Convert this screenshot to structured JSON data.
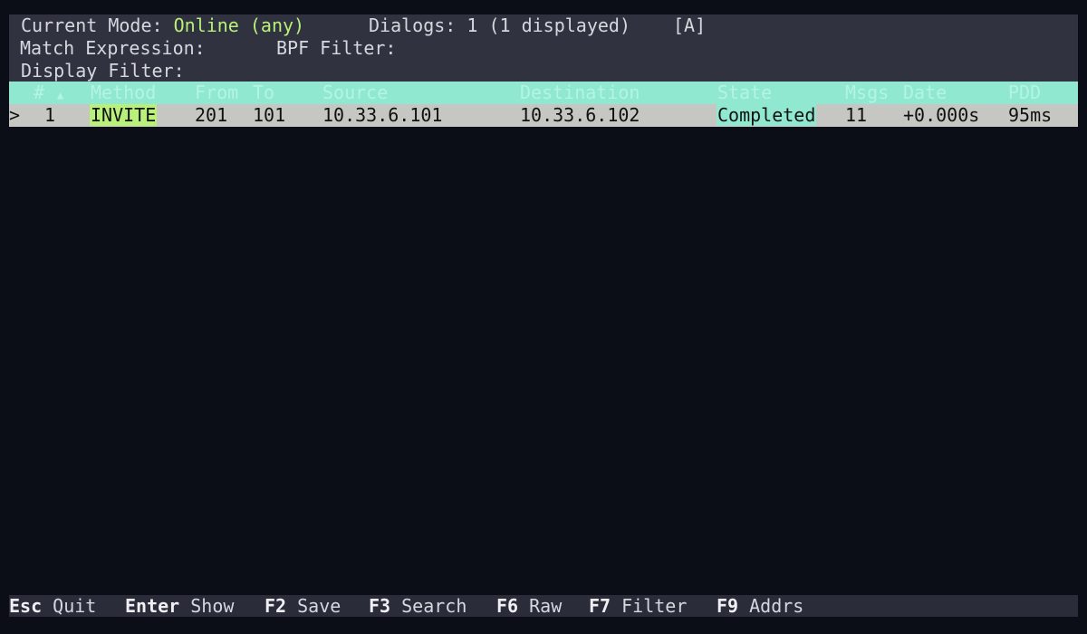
{
  "header": {
    "mode_label": "Current Mode: ",
    "mode_value": "Online (any)",
    "dialogs_text": "Dialogs: 1 (1 displayed)",
    "indicator": "[A]",
    "match_expression_label": "Match Expression:",
    "bpf_filter_label": "BPF Filter:",
    "display_filter_label": "Display Filter:"
  },
  "columns": {
    "num": "#",
    "sort": "▲",
    "method": "Method",
    "from": "From",
    "to": "To",
    "source": "Source",
    "destination": "Destination",
    "state": "State",
    "msgs": "Msgs",
    "date": "Date",
    "pdd": "PDD"
  },
  "rows": [
    {
      "selector": ">",
      "num": "1",
      "method": "INVITE",
      "from": "201",
      "to": "101",
      "source": "10.33.6.101",
      "destination": "10.33.6.102",
      "state": "Completed",
      "msgs": "11",
      "date": "+0.000s",
      "pdd": "95ms"
    }
  ],
  "footer": [
    {
      "key": "Esc",
      "label": "Quit"
    },
    {
      "key": "Enter",
      "label": "Show"
    },
    {
      "key": "F2",
      "label": "Save"
    },
    {
      "key": "F3",
      "label": "Search"
    },
    {
      "key": "F6",
      "label": "Raw"
    },
    {
      "key": "F7",
      "label": "Filter"
    },
    {
      "key": "F9",
      "label": "Addrs"
    }
  ],
  "colors": {
    "background": "#0b0e16",
    "header_bg": "#31323f",
    "column_header_bg": "#90e8d0",
    "row_bg": "#c6c6c2",
    "accent_green": "#b9f07a",
    "footer_bg": "#2b2c3a"
  }
}
